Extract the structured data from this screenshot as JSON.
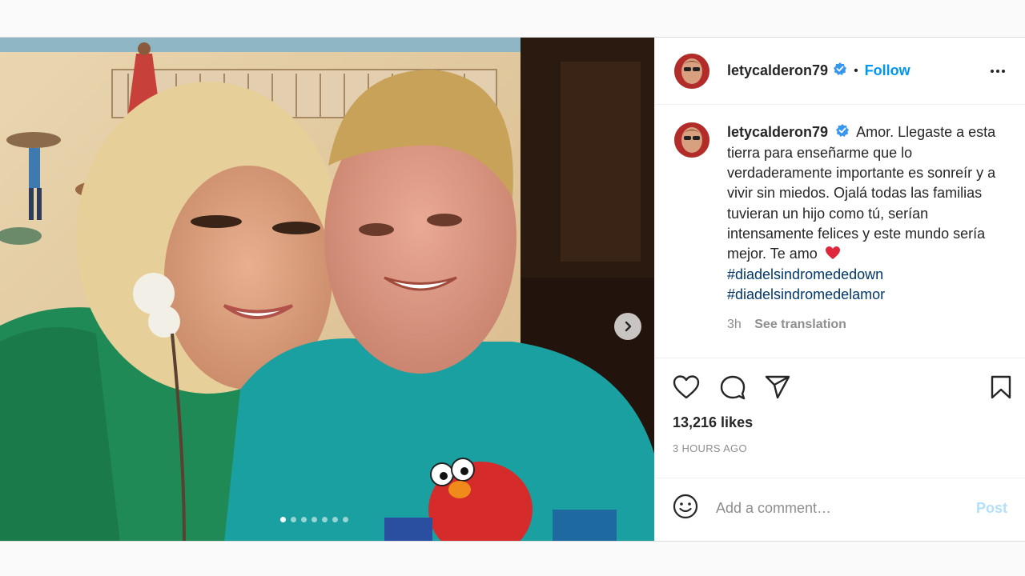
{
  "post": {
    "username": "letycalderon79",
    "follow_label": "Follow",
    "bullet": "•",
    "caption_text": "Amor. Llegaste a esta tierra para enseñarme que lo verdaderamente importante es sonreír y a vivir sin miedos. Ojalá todas las familias tuvieran un hijo como tú, serían intensamente felices y este mundo sería mejor. Te amo",
    "caption_emoji": "❤️",
    "hashtags": [
      "#diadelsindromededown",
      "#diadelsindromedelamor"
    ],
    "relative_time": "3h",
    "see_translation": "See translation",
    "likes": "13,216 likes",
    "timestamp": "3 HOURS AGO",
    "comment_placeholder": "Add a comment…",
    "post_button": "Post"
  },
  "carousel": {
    "current_index": 1,
    "total": 7
  },
  "icons": {
    "verified": "verified-badge-icon",
    "more": "more-options-icon",
    "like": "heart-icon",
    "comment": "comment-bubble-icon",
    "share": "paper-plane-icon",
    "save": "bookmark-icon",
    "emoji": "smiley-icon",
    "next": "chevron-right-icon"
  },
  "colors": {
    "accent": "#0095f6",
    "hashtag": "#00376b",
    "post_disabled": "#b2dffc",
    "heart": "#ed4956"
  }
}
